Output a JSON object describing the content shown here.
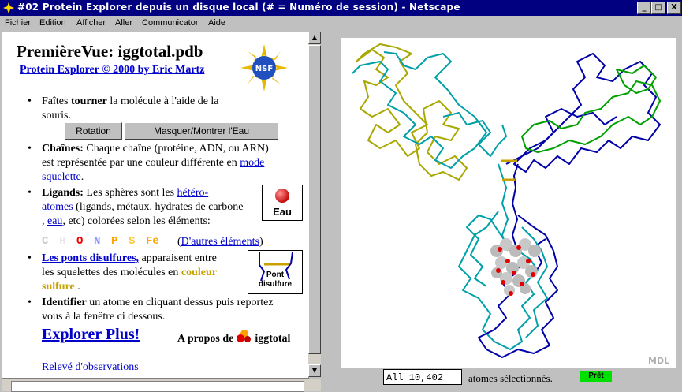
{
  "window": {
    "title": "#02 Protein Explorer depuis un disque local (# = Numéro de session) - Netscape",
    "buttons": {
      "minimize": "_",
      "maximize": "□",
      "close": "X"
    }
  },
  "menu": [
    "Fichier",
    "Edition",
    "Afficher",
    "Aller",
    "Communicator",
    "Aide"
  ],
  "left": {
    "title": "PremièreVue: iggtotal.pdb",
    "credit": "Protein Explorer © 2000 by Eric Martz",
    "nsf_label": "NSF",
    "b1": {
      "pre": "Faîtes ",
      "bold": "tourner",
      "post1": " la molécule à l'aide de la",
      "post2": "souris."
    },
    "btn_rotation": "Rotation",
    "btn_water": "Masquer/Montrer l'Eau",
    "b2": {
      "bold": "Chaînes:",
      "l1": " Chaque chaîne (protéine, ADN, ou ARN)",
      "l2": "est représentée par une couleur différente en ",
      "link1": "mode",
      "link2": "squelette",
      "end": "."
    },
    "b3": {
      "bold": "Ligands:",
      "l1": " Les sphères sont les ",
      "link1": "hétéro-",
      "link2": "atomes",
      "l2": " (ligands, métaux, hydrates de carbone",
      "l3a": ", ",
      "link3": "eau",
      "l3b": ", etc) colorées selon les éléments:"
    },
    "eau_label": "Eau",
    "elements": [
      {
        "sym": "C",
        "color": "#c8c8c8"
      },
      {
        "sym": "H",
        "color": "#e8e8e8"
      },
      {
        "sym": "O",
        "color": "#f00000"
      },
      {
        "sym": "N",
        "color": "#8f8fff"
      },
      {
        "sym": "P",
        "color": "#ffa500"
      },
      {
        "sym": "S",
        "color": "#ffc832"
      },
      {
        "sym": "Fe",
        "color": "#ffa500"
      }
    ],
    "other_elements": {
      "open": "(",
      "link": "D'autres éléments",
      "close": ")"
    },
    "b4": {
      "link": "Les ponts disulfures,",
      "l1": " apparaisent entre",
      "l2": "les squelettes des molécules en ",
      "bold": "couleur",
      "bold2": "sulfure",
      "end": " ."
    },
    "pont_label1": "Pont",
    "pont_label2": "disulfure",
    "b5": {
      "bold": "Identifier",
      "l1": " un atome en cliquant dessus puis reportez",
      "l2": "vous à la fenêtre ci dessous."
    },
    "explore_more": "Explorer Plus!",
    "about": {
      "pre": "A propos de ",
      "post": "iggtotal"
    },
    "notes_link": "Relevé d'observations"
  },
  "viewer": {
    "watermark": "MDL",
    "command_value": "All 10,402",
    "selected_text": "atomes sélectionnés.",
    "status": "Prêt"
  },
  "colors": {
    "titlebar": "#000080",
    "link": "#0000cc",
    "sulfur": "#c8a000",
    "chain_yellow": "#a8a800",
    "chain_cyan": "#00a0a8",
    "chain_blue": "#0000a8",
    "chain_green": "#00a000"
  }
}
